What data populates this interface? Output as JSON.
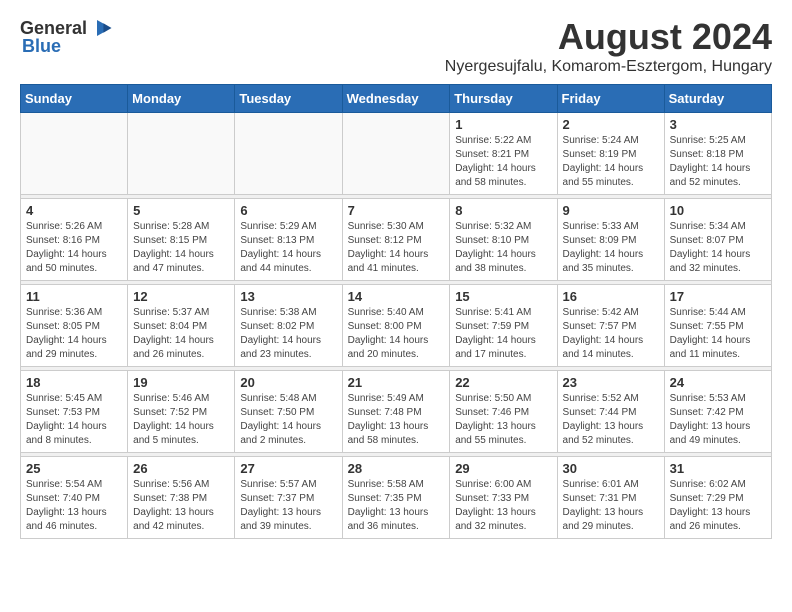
{
  "logo": {
    "general": "General",
    "blue": "Blue"
  },
  "title": "August 2024",
  "location": "Nyergesujfalu, Komarom-Esztergom, Hungary",
  "headers": [
    "Sunday",
    "Monday",
    "Tuesday",
    "Wednesday",
    "Thursday",
    "Friday",
    "Saturday"
  ],
  "weeks": [
    {
      "days": [
        {
          "num": "",
          "info": ""
        },
        {
          "num": "",
          "info": ""
        },
        {
          "num": "",
          "info": ""
        },
        {
          "num": "",
          "info": ""
        },
        {
          "num": "1",
          "info": "Sunrise: 5:22 AM\nSunset: 8:21 PM\nDaylight: 14 hours\nand 58 minutes."
        },
        {
          "num": "2",
          "info": "Sunrise: 5:24 AM\nSunset: 8:19 PM\nDaylight: 14 hours\nand 55 minutes."
        },
        {
          "num": "3",
          "info": "Sunrise: 5:25 AM\nSunset: 8:18 PM\nDaylight: 14 hours\nand 52 minutes."
        }
      ]
    },
    {
      "days": [
        {
          "num": "4",
          "info": "Sunrise: 5:26 AM\nSunset: 8:16 PM\nDaylight: 14 hours\nand 50 minutes."
        },
        {
          "num": "5",
          "info": "Sunrise: 5:28 AM\nSunset: 8:15 PM\nDaylight: 14 hours\nand 47 minutes."
        },
        {
          "num": "6",
          "info": "Sunrise: 5:29 AM\nSunset: 8:13 PM\nDaylight: 14 hours\nand 44 minutes."
        },
        {
          "num": "7",
          "info": "Sunrise: 5:30 AM\nSunset: 8:12 PM\nDaylight: 14 hours\nand 41 minutes."
        },
        {
          "num": "8",
          "info": "Sunrise: 5:32 AM\nSunset: 8:10 PM\nDaylight: 14 hours\nand 38 minutes."
        },
        {
          "num": "9",
          "info": "Sunrise: 5:33 AM\nSunset: 8:09 PM\nDaylight: 14 hours\nand 35 minutes."
        },
        {
          "num": "10",
          "info": "Sunrise: 5:34 AM\nSunset: 8:07 PM\nDaylight: 14 hours\nand 32 minutes."
        }
      ]
    },
    {
      "days": [
        {
          "num": "11",
          "info": "Sunrise: 5:36 AM\nSunset: 8:05 PM\nDaylight: 14 hours\nand 29 minutes."
        },
        {
          "num": "12",
          "info": "Sunrise: 5:37 AM\nSunset: 8:04 PM\nDaylight: 14 hours\nand 26 minutes."
        },
        {
          "num": "13",
          "info": "Sunrise: 5:38 AM\nSunset: 8:02 PM\nDaylight: 14 hours\nand 23 minutes."
        },
        {
          "num": "14",
          "info": "Sunrise: 5:40 AM\nSunset: 8:00 PM\nDaylight: 14 hours\nand 20 minutes."
        },
        {
          "num": "15",
          "info": "Sunrise: 5:41 AM\nSunset: 7:59 PM\nDaylight: 14 hours\nand 17 minutes."
        },
        {
          "num": "16",
          "info": "Sunrise: 5:42 AM\nSunset: 7:57 PM\nDaylight: 14 hours\nand 14 minutes."
        },
        {
          "num": "17",
          "info": "Sunrise: 5:44 AM\nSunset: 7:55 PM\nDaylight: 14 hours\nand 11 minutes."
        }
      ]
    },
    {
      "days": [
        {
          "num": "18",
          "info": "Sunrise: 5:45 AM\nSunset: 7:53 PM\nDaylight: 14 hours\nand 8 minutes."
        },
        {
          "num": "19",
          "info": "Sunrise: 5:46 AM\nSunset: 7:52 PM\nDaylight: 14 hours\nand 5 minutes."
        },
        {
          "num": "20",
          "info": "Sunrise: 5:48 AM\nSunset: 7:50 PM\nDaylight: 14 hours\nand 2 minutes."
        },
        {
          "num": "21",
          "info": "Sunrise: 5:49 AM\nSunset: 7:48 PM\nDaylight: 13 hours\nand 58 minutes."
        },
        {
          "num": "22",
          "info": "Sunrise: 5:50 AM\nSunset: 7:46 PM\nDaylight: 13 hours\nand 55 minutes."
        },
        {
          "num": "23",
          "info": "Sunrise: 5:52 AM\nSunset: 7:44 PM\nDaylight: 13 hours\nand 52 minutes."
        },
        {
          "num": "24",
          "info": "Sunrise: 5:53 AM\nSunset: 7:42 PM\nDaylight: 13 hours\nand 49 minutes."
        }
      ]
    },
    {
      "days": [
        {
          "num": "25",
          "info": "Sunrise: 5:54 AM\nSunset: 7:40 PM\nDaylight: 13 hours\nand 46 minutes."
        },
        {
          "num": "26",
          "info": "Sunrise: 5:56 AM\nSunset: 7:38 PM\nDaylight: 13 hours\nand 42 minutes."
        },
        {
          "num": "27",
          "info": "Sunrise: 5:57 AM\nSunset: 7:37 PM\nDaylight: 13 hours\nand 39 minutes."
        },
        {
          "num": "28",
          "info": "Sunrise: 5:58 AM\nSunset: 7:35 PM\nDaylight: 13 hours\nand 36 minutes."
        },
        {
          "num": "29",
          "info": "Sunrise: 6:00 AM\nSunset: 7:33 PM\nDaylight: 13 hours\nand 32 minutes."
        },
        {
          "num": "30",
          "info": "Sunrise: 6:01 AM\nSunset: 7:31 PM\nDaylight: 13 hours\nand 29 minutes."
        },
        {
          "num": "31",
          "info": "Sunrise: 6:02 AM\nSunset: 7:29 PM\nDaylight: 13 hours\nand 26 minutes."
        }
      ]
    }
  ]
}
